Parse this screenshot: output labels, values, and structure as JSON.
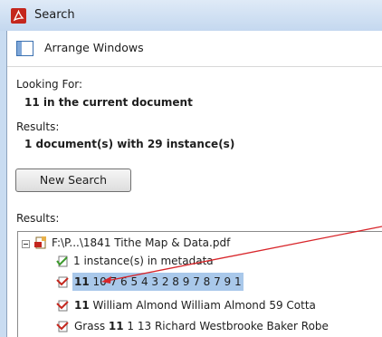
{
  "window": {
    "title": "Search"
  },
  "toolbar": {
    "arrange_label": "Arrange Windows"
  },
  "looking_for": {
    "label": "Looking For:",
    "value": "11 in the current document"
  },
  "results_summary": {
    "label": "Results:",
    "value": "1 document(s) with 29 instance(s)"
  },
  "new_search_button": "New Search",
  "results_list": {
    "label": "Results:",
    "file": "F:\\P...\\1841 Tithe Map & Data.pdf",
    "metadata": "1 instance(s) in metadata",
    "items": [
      {
        "term": "11",
        "rest": " 10 7 6 5 4 3 2 8 9 7 8 7 9 1"
      },
      {
        "term": "11",
        "rest": " William Almond William Almond 59 Cotta"
      },
      {
        "pre": "Grass ",
        "term": "11",
        "rest": " 1 13 Richard Westbrooke Baker Robe"
      }
    ]
  },
  "colors": {
    "title_bar": "#c9dcf1",
    "selection": "#a9c8ea",
    "arrow": "#d8252a",
    "pdf_red": "#c4261d"
  }
}
